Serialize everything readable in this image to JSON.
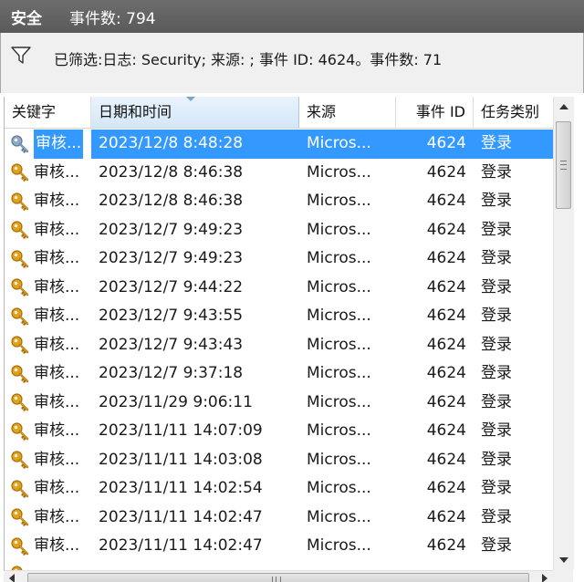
{
  "titlebar": {
    "log_name": "安全",
    "event_count": "事件数: 794"
  },
  "filter": {
    "icon": "funnel-icon",
    "text": "已筛选:日志: Security; 来源: ; 事件 ID: 4624。事件数: 71"
  },
  "columns": {
    "keyword": "关键字",
    "datetime": "日期和时间",
    "source": "来源",
    "event_id": "事件 ID",
    "task_category": "任务类别",
    "sorted_column": "datetime"
  },
  "rows": [
    {
      "keyword": "审核...",
      "datetime": "2023/12/8 8:48:28",
      "source": "Micros...",
      "event_id": "4624",
      "task": "登录",
      "selected": true,
      "icon": "key-icon"
    },
    {
      "keyword": "审核...",
      "datetime": "2023/12/8 8:46:38",
      "source": "Micros...",
      "event_id": "4624",
      "task": "登录",
      "icon": "key-icon"
    },
    {
      "keyword": "审核...",
      "datetime": "2023/12/8 8:46:38",
      "source": "Micros...",
      "event_id": "4624",
      "task": "登录",
      "icon": "key-icon"
    },
    {
      "keyword": "审核...",
      "datetime": "2023/12/7 9:49:23",
      "source": "Micros...",
      "event_id": "4624",
      "task": "登录",
      "icon": "key-icon"
    },
    {
      "keyword": "审核...",
      "datetime": "2023/12/7 9:49:23",
      "source": "Micros...",
      "event_id": "4624",
      "task": "登录",
      "icon": "key-icon"
    },
    {
      "keyword": "审核...",
      "datetime": "2023/12/7 9:44:22",
      "source": "Micros...",
      "event_id": "4624",
      "task": "登录",
      "icon": "key-icon"
    },
    {
      "keyword": "审核...",
      "datetime": "2023/12/7 9:43:55",
      "source": "Micros...",
      "event_id": "4624",
      "task": "登录",
      "icon": "key-icon"
    },
    {
      "keyword": "审核...",
      "datetime": "2023/12/7 9:43:43",
      "source": "Micros...",
      "event_id": "4624",
      "task": "登录",
      "icon": "key-icon"
    },
    {
      "keyword": "审核...",
      "datetime": "2023/12/7 9:37:18",
      "source": "Micros...",
      "event_id": "4624",
      "task": "登录",
      "icon": "key-icon"
    },
    {
      "keyword": "审核...",
      "datetime": "2023/11/29 9:06:11",
      "source": "Micros...",
      "event_id": "4624",
      "task": "登录",
      "icon": "key-icon"
    },
    {
      "keyword": "审核...",
      "datetime": "2023/11/11 14:07:09",
      "source": "Micros...",
      "event_id": "4624",
      "task": "登录",
      "icon": "key-icon"
    },
    {
      "keyword": "审核...",
      "datetime": "2023/11/11 14:03:08",
      "source": "Micros...",
      "event_id": "4624",
      "task": "登录",
      "icon": "key-icon"
    },
    {
      "keyword": "审核...",
      "datetime": "2023/11/11 14:02:54",
      "source": "Micros...",
      "event_id": "4624",
      "task": "登录",
      "icon": "key-icon"
    },
    {
      "keyword": "审核...",
      "datetime": "2023/11/11 14:02:47",
      "source": "Micros...",
      "event_id": "4624",
      "task": "登录",
      "icon": "key-icon"
    },
    {
      "keyword": "审核...",
      "datetime": "2023/11/11 14:02:47",
      "source": "Micros...",
      "event_id": "4624",
      "task": "登录",
      "icon": "key-icon"
    },
    {
      "keyword": "",
      "datetime": "",
      "source": "",
      "event_id": "",
      "task": "",
      "icon": "key-icon"
    }
  ],
  "colors": {
    "titlebar": "#5f5f5f",
    "selection": "#3399ff",
    "key_gold": "#e0a21c",
    "key_selected": "#8fa9c4"
  }
}
